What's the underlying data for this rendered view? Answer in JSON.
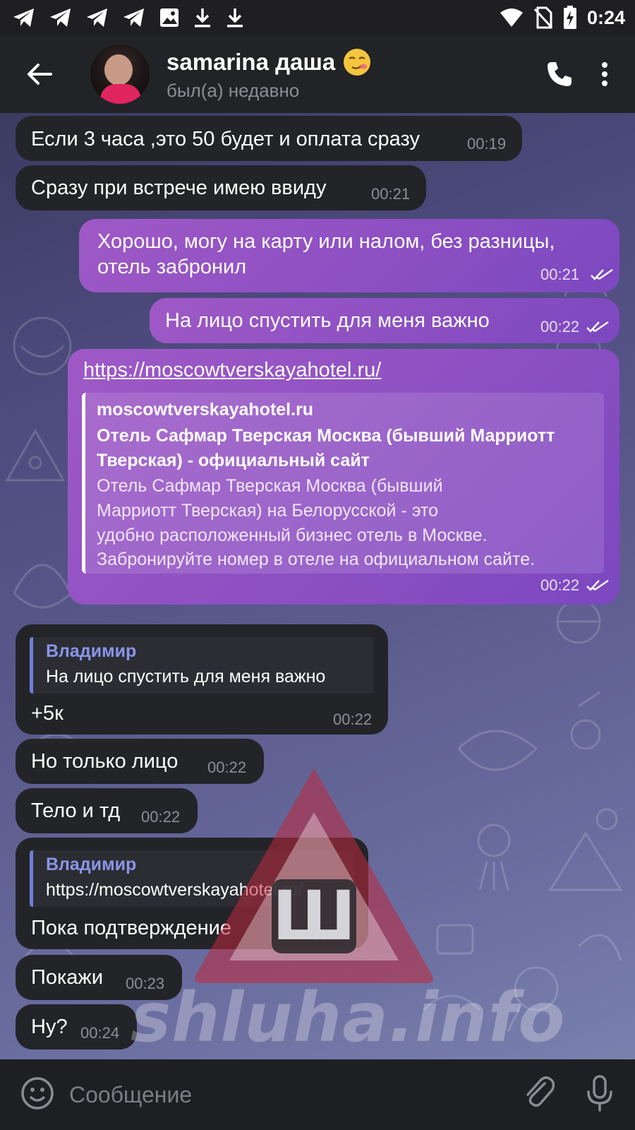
{
  "status_bar": {
    "time": "0:24",
    "left_icons": [
      "telegram-icon",
      "telegram-icon",
      "telegram-icon",
      "telegram-icon",
      "image-icon",
      "download-icon",
      "download-icon"
    ],
    "right_icons": [
      "wifi-icon",
      "no-sim-icon",
      "battery-charging-icon"
    ]
  },
  "header": {
    "name": "samarina даша",
    "status": "был(а) недавно"
  },
  "messages": [
    {
      "side": "in",
      "text": "Если 3 часа ,это 50 будет и оплата сразу",
      "time": "00:19"
    },
    {
      "side": "in",
      "text": "Сразу при встрече имею ввиду",
      "time": "00:21"
    },
    {
      "side": "out",
      "text_line1": "Хорошо, могу на карту или налом, без разницы,",
      "text_line2": "отель забронил",
      "time": "00:21"
    },
    {
      "side": "out",
      "text": "На лицо спустить для меня важно",
      "time": "00:22"
    },
    {
      "side": "out",
      "link": "https://moscowtverskayahotel.ru/",
      "preview_site": "moscowtverskayahotel.ru",
      "preview_title_1": "Отель Сафмар Тверская Москва (бывший Марриотт",
      "preview_title_2": "Тверская) - официальный сайт",
      "preview_desc_1": "Отель Сафмар Тверская Москва (бывший",
      "preview_desc_2": "Марриотт Тверская) на Белорусской - это",
      "preview_desc_3": "удобно расположенный бизнес отель в Москве.",
      "preview_desc_4": "Забронируйте номер в отеле на официальном сайте.",
      "time": "00:22"
    },
    {
      "side": "in",
      "reply_author": "Владимир",
      "reply_text": "На лицо спустить для меня важно",
      "text": "+5к",
      "time": "00:22"
    },
    {
      "side": "in",
      "text": "Но только лицо",
      "time": "00:22"
    },
    {
      "side": "in",
      "text": "Тело и тд",
      "time": "00:22"
    },
    {
      "side": "in",
      "reply_author": "Владимир",
      "reply_text": "https://moscowtverskayahotel.ru/",
      "text": "Пока подтверждение",
      "time": "00:22"
    },
    {
      "side": "in",
      "text": "Покажи",
      "time": "00:23"
    },
    {
      "side": "in",
      "text": "Ну?",
      "time": "00:24"
    }
  ],
  "watermark": {
    "letter": "Ш",
    "text": "shluha.info",
    "color": "#c0283c"
  },
  "input": {
    "placeholder": "Сообщение"
  },
  "colors": {
    "outgoing": "#8b4fc2",
    "incoming": "#232428",
    "reply_accent": "#6f7bd8"
  }
}
